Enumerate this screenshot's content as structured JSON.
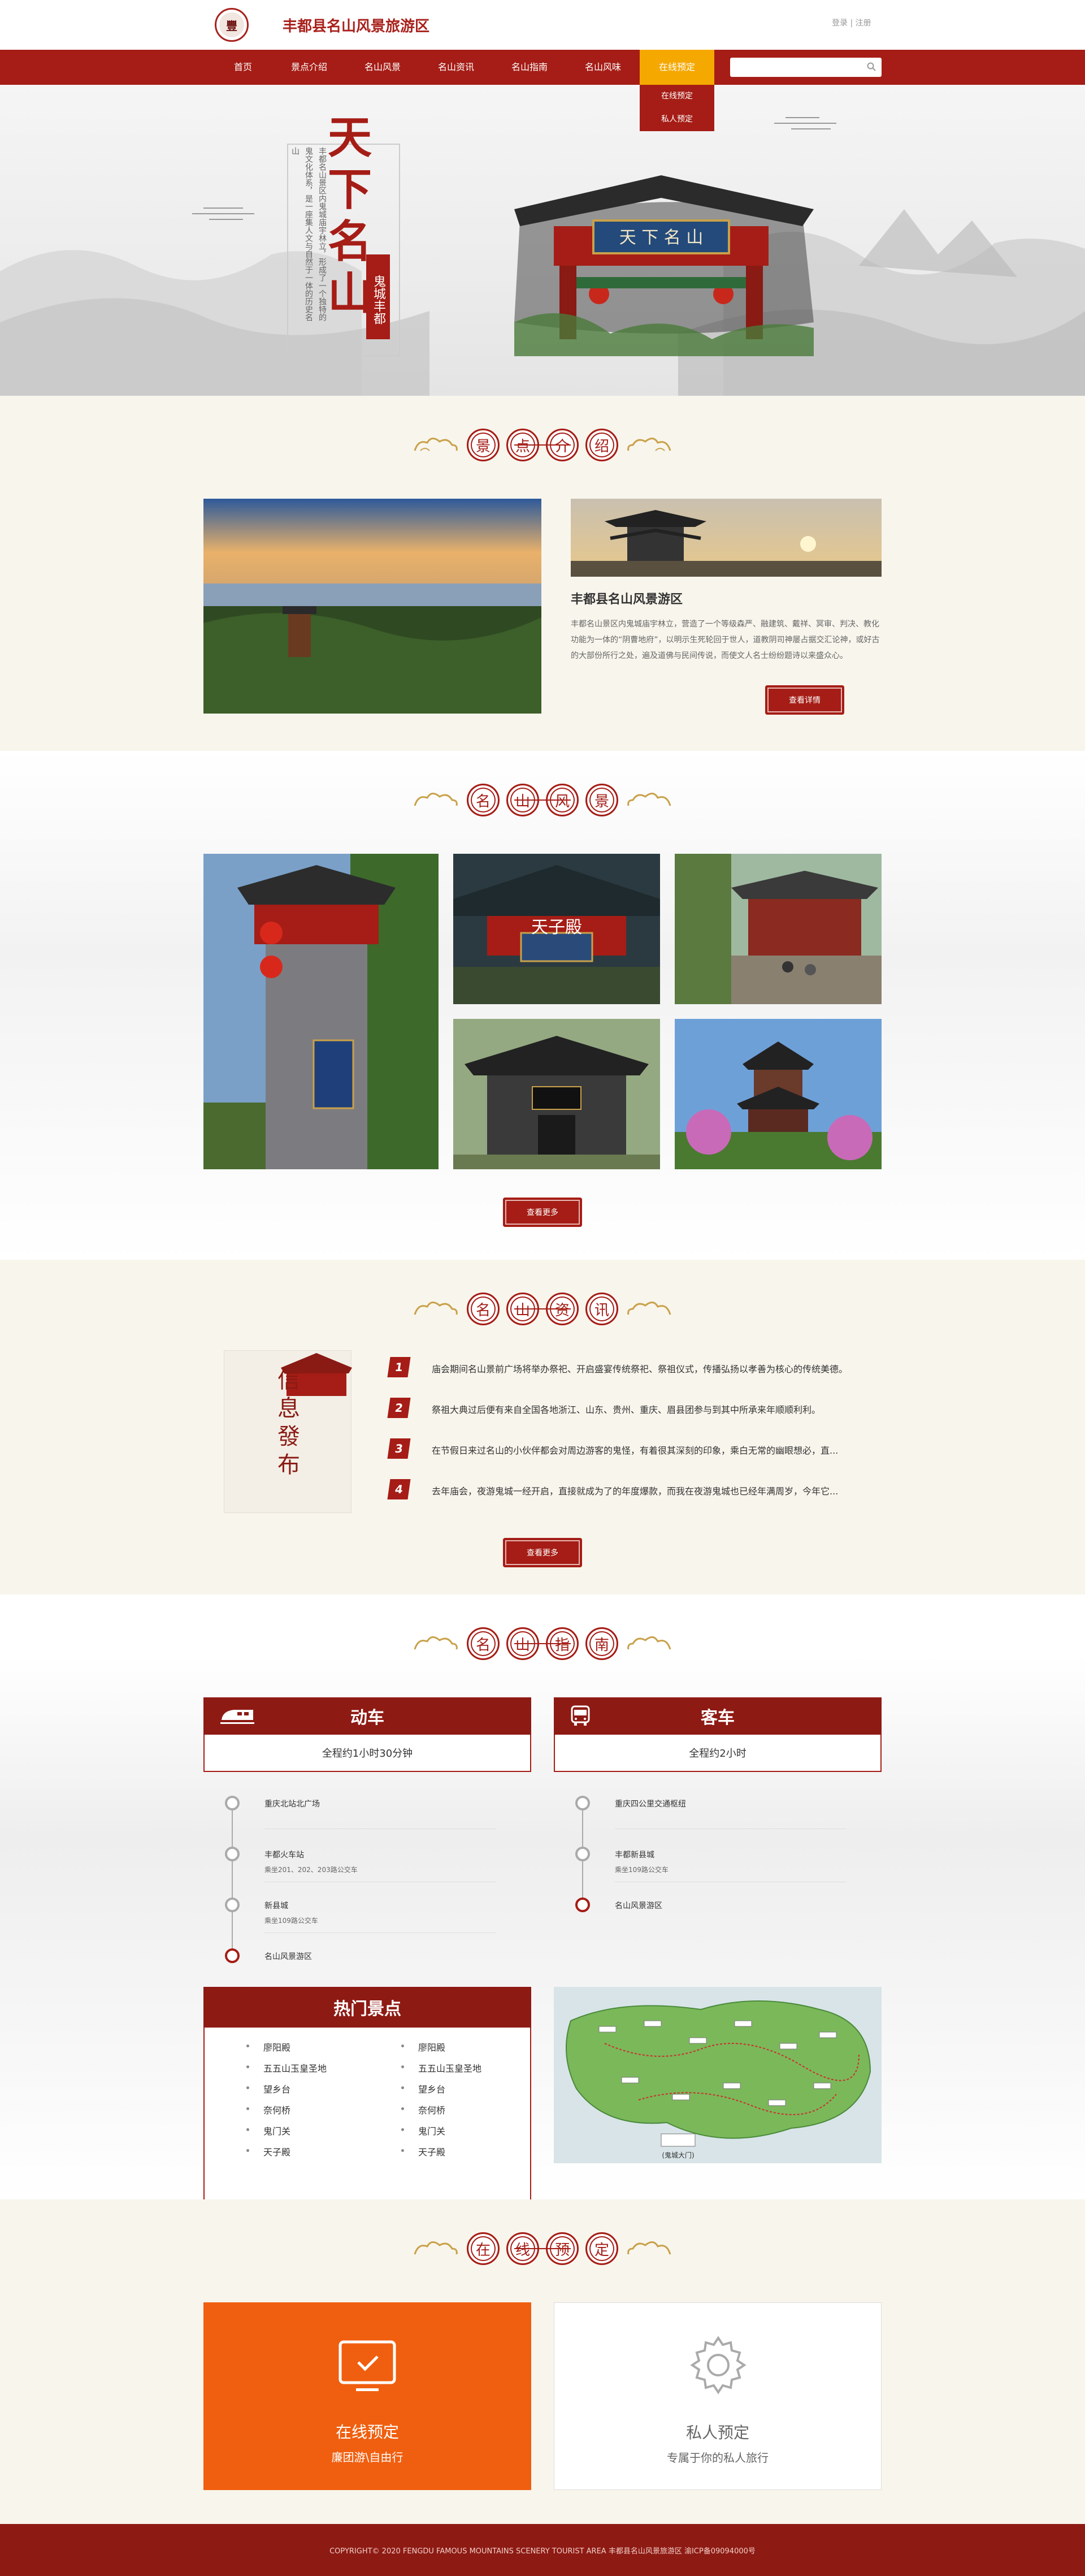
{
  "header": {
    "site_title": "丰都县名山风景旅游区",
    "logo_char": "豐",
    "login_links": "登录 | 注册"
  },
  "nav": {
    "items": [
      "首页",
      "景点介绍",
      "名山风景",
      "名山资讯",
      "名山指南",
      "名山风味",
      "在线预定"
    ],
    "dropdown": [
      "在线预定",
      "私人预定"
    ],
    "search_placeholder": ""
  },
  "banner": {
    "title": "天下名山",
    "seal": "鬼城丰都",
    "poem": "丰都名山景区内鬼城庙宇林立，形成了一个独特的鬼文化体系，是一座集人文与自然于一体的历史名山",
    "gate_plaque": "天 下 名 山",
    "slides_total": 3,
    "slides_active": 1
  },
  "intro": {
    "heading": [
      "景",
      "点",
      "介",
      "绍"
    ],
    "title": "丰都县名山风景游区",
    "paragraph": "丰都名山景区内鬼城庙宇林立，营造了一个等级森严、融建筑、戴祥、冥审、判决、教化功能为一体的“阴曹地府”，以明示生死轮回于世人，道教阴司神屡占据交汇论神，或好古的大部份所行之处，遍及道佛与民间传说，而使文人名士纷纷题诗以来盛众心。",
    "more_button": "查看详情"
  },
  "scenery": {
    "heading": [
      "名",
      "山",
      "风",
      "景"
    ],
    "caption_tianzi": "天子殿",
    "more_button": "查看更多"
  },
  "news": {
    "heading": [
      "名",
      "山",
      "资",
      "讯"
    ],
    "poster": "信息發布",
    "items": [
      {
        "num": "1",
        "text": "庙会期间名山景前广场将举办祭祀、开启盛宴传统祭祀、祭祖仪式，传播弘扬以孝善为核心的传统美德。"
      },
      {
        "num": "2",
        "text": "祭祖大典过后便有来自全国各地浙江、山东、贵州、重庆、眉县团参与到其中所承来年顺顺利利。"
      },
      {
        "num": "3",
        "text": "在节假日来过名山的小伙伴都会对周边游客的鬼怪，有着很其深刻的印象，乘白无常的幽眼想必，直..."
      },
      {
        "num": "4",
        "text": "去年庙会，夜游鬼城一经开启，直接就成为了的年度爆款，而我在夜游鬼城也已经年满周岁，今年它..."
      }
    ],
    "more_button": "查看更多"
  },
  "guide": {
    "heading": [
      "名",
      "山",
      "指",
      "南"
    ],
    "train": {
      "title": "动车",
      "duration": "全程约1小时30分钟",
      "stops": [
        {
          "name": "重庆北站北广场",
          "detail": ""
        },
        {
          "name": "丰都火车站",
          "detail": "乘坐201、202、203路公交车"
        },
        {
          "name": "新县城",
          "detail": "乘坐109路公交车"
        },
        {
          "name": "名山风景游区",
          "detail": ""
        }
      ]
    },
    "bus": {
      "title": "客车",
      "duration": "全程约2小时",
      "stops": [
        {
          "name": "重庆四公里交通枢纽",
          "detail": ""
        },
        {
          "name": "丰都新县城",
          "detail": "乘坐109路公交车"
        },
        {
          "name": "名山风景游区",
          "detail": ""
        }
      ]
    },
    "hot": {
      "title": "热门景点",
      "left": [
        "廖阳殿",
        "五五山玉皇圣地",
        "望乡台",
        "奈何桥",
        "鬼门关",
        "天子殿"
      ],
      "right": [
        "廖阳殿",
        "五五山玉皇圣地",
        "望乡台",
        "奈何桥",
        "鬼门关",
        "天子殿"
      ]
    },
    "map_caption": "(鬼城大门)"
  },
  "booking": {
    "heading": [
      "在",
      "线",
      "预",
      "定"
    ],
    "online": {
      "label": "在线预定",
      "sub": "廉团游\\自由行"
    },
    "private": {
      "label": "私人预定",
      "sub": "专属于你的私人旅行"
    }
  },
  "footer": {
    "text": "COPYRIGHT© 2020 FENGDU FAMOUS MOUNTAINS SCENERY TOURIST AREA  丰都县名山风景旅游区  渝ICP备09094000号"
  },
  "colors": {
    "primary": "#a51d16",
    "nav_active": "#f5a800",
    "cream": "#f8f5ec",
    "orange": "#f05f0f"
  },
  "icons": [
    "search-icon",
    "train-icon",
    "bus-icon",
    "monitor-check-icon",
    "gear-icon",
    "cloud-ornament-icon"
  ]
}
